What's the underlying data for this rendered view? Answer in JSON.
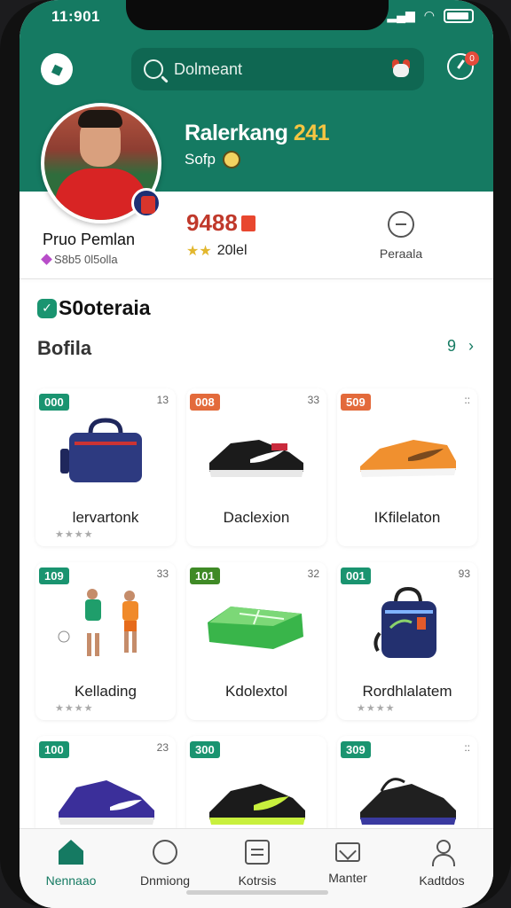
{
  "status": {
    "time": "11:901"
  },
  "search": {
    "text": "Dolmeant"
  },
  "notifications": {
    "badge": "0"
  },
  "hero": {
    "name": "Ralerkang",
    "number": "241",
    "subtitle": "Sofp"
  },
  "profile": {
    "name": "Pruo Pemlan",
    "meta": "S8b5 0l5olla"
  },
  "stats": {
    "value": "9488",
    "rating_text": "20lel",
    "stars": "★★"
  },
  "peer": {
    "label": "Peraala"
  },
  "brand": {
    "name": "S0oteraia"
  },
  "section": {
    "title": "Bofila",
    "more_icon": "9",
    "chevron": "›"
  },
  "products": [
    {
      "tag": "000",
      "tag_color": "#1a9470",
      "count": "13",
      "title": "lervartonk",
      "stars": "★★★★"
    },
    {
      "tag": "008",
      "tag_color": "#e36a3b",
      "count": "33",
      "title": "Daclexion",
      "stars": ""
    },
    {
      "tag": "509",
      "tag_color": "#e36a3b",
      "count": "::",
      "title": "IKfilelaton",
      "stars": ""
    },
    {
      "tag": "109",
      "tag_color": "#1a9470",
      "count": "33",
      "title": "Kellading",
      "stars": "★★★★"
    },
    {
      "tag": "101",
      "tag_color": "#3f8a26",
      "count": "32",
      "title": "Kdolextol",
      "stars": ""
    },
    {
      "tag": "001",
      "tag_color": "#1a9470",
      "count": "93",
      "title": "Rordhlalatem",
      "stars": "★★★★"
    },
    {
      "tag": "100",
      "tag_color": "#1a9470",
      "count": "23",
      "title": "",
      "stars": ""
    },
    {
      "tag": "300",
      "tag_color": "#1a9470",
      "count": "",
      "title": "",
      "stars": ""
    },
    {
      "tag": "309",
      "tag_color": "#1a9470",
      "count": "::",
      "title": "",
      "stars": ""
    }
  ],
  "nav": [
    {
      "label": "Nennaao",
      "icon": "home-icon"
    },
    {
      "label": "Dnmiong",
      "icon": "chat-icon"
    },
    {
      "label": "Kotrsis",
      "icon": "doc-icon"
    },
    {
      "label": "Manter",
      "icon": "mail-icon"
    },
    {
      "label": "Kadtdos",
      "icon": "user-icon"
    }
  ]
}
